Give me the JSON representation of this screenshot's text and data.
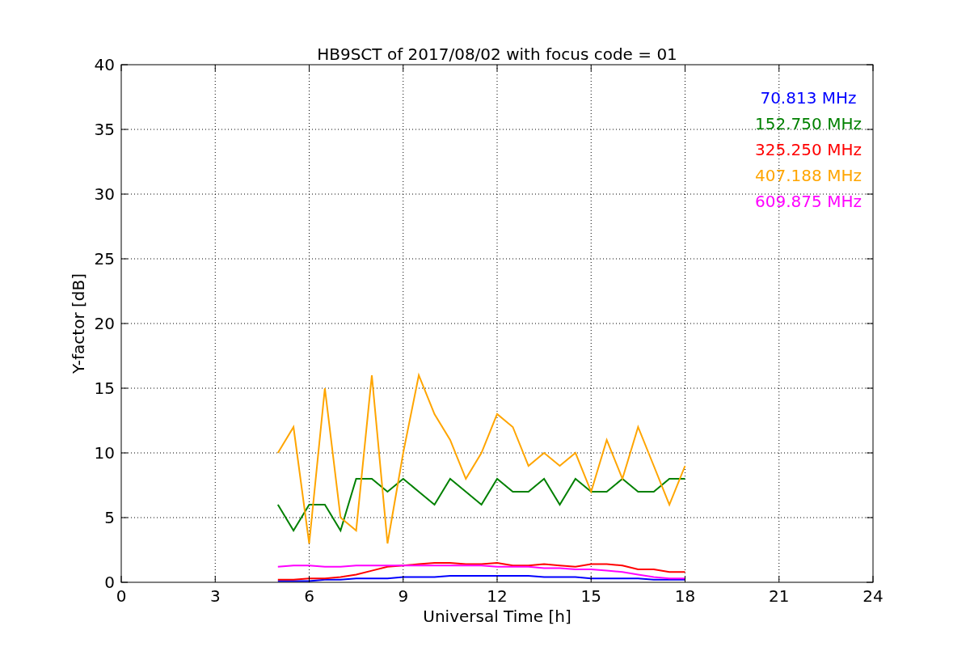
{
  "figure": {
    "chart_data": {
      "type": "line",
      "title": "HB9SCT of 2017/08/02 with focus code = 01",
      "xlabel": "Universal Time [h]",
      "ylabel": "Y-factor [dB]",
      "x": [
        5,
        5.5,
        6,
        6.5,
        7,
        7.5,
        8,
        8.5,
        9,
        9.5,
        10,
        10.5,
        11,
        11.5,
        12,
        12.5,
        13,
        13.5,
        14,
        14.5,
        15,
        15.5,
        16,
        16.5,
        17,
        17.5,
        18
      ],
      "series": [
        {
          "name": "70.813 MHz",
          "color": "#0000ff",
          "values": [
            0.1,
            0.1,
            0.1,
            0.2,
            0.2,
            0.3,
            0.3,
            0.3,
            0.4,
            0.4,
            0.4,
            0.5,
            0.5,
            0.5,
            0.5,
            0.5,
            0.5,
            0.4,
            0.4,
            0.4,
            0.3,
            0.3,
            0.3,
            0.3,
            0.2,
            0.2,
            0.2
          ]
        },
        {
          "name": "152.750 MHz",
          "color": "#008000",
          "values": [
            6,
            4,
            6,
            6,
            4,
            8,
            8,
            7,
            8,
            7,
            6,
            8,
            7,
            6,
            8,
            7,
            7,
            8,
            6,
            8,
            7,
            7,
            8,
            7,
            7,
            8,
            8
          ]
        },
        {
          "name": "325.250 MHz",
          "color": "#ff0000",
          "values": [
            0.2,
            0.2,
            0.3,
            0.3,
            0.4,
            0.6,
            0.9,
            1.2,
            1.3,
            1.4,
            1.5,
            1.5,
            1.4,
            1.4,
            1.5,
            1.3,
            1.3,
            1.4,
            1.3,
            1.2,
            1.4,
            1.4,
            1.3,
            1,
            1,
            0.8,
            0.8
          ]
        },
        {
          "name": "407.188 MHz",
          "color": "#ffa500",
          "values": [
            10,
            12,
            3,
            15,
            5,
            4,
            16,
            3,
            10,
            16,
            13,
            11,
            8,
            10,
            13,
            12,
            9,
            10,
            9,
            10,
            7,
            11,
            8,
            12,
            9,
            6,
            9
          ]
        },
        {
          "name": "609.875 MHz",
          "color": "#ff00ff",
          "values": [
            1.2,
            1.3,
            1.3,
            1.2,
            1.2,
            1.3,
            1.3,
            1.3,
            1.3,
            1.3,
            1.3,
            1.3,
            1.3,
            1.3,
            1.2,
            1.2,
            1.2,
            1.1,
            1.1,
            1,
            1,
            0.9,
            0.8,
            0.6,
            0.4,
            0.3,
            0.3
          ]
        }
      ],
      "xlim": [
        0,
        24
      ],
      "ylim": [
        0,
        40
      ],
      "xticks": [
        0,
        3,
        6,
        9,
        12,
        15,
        18,
        21,
        24
      ],
      "yticks": [
        0,
        5,
        10,
        15,
        20,
        25,
        30,
        35,
        40
      ],
      "grid": true
    }
  }
}
